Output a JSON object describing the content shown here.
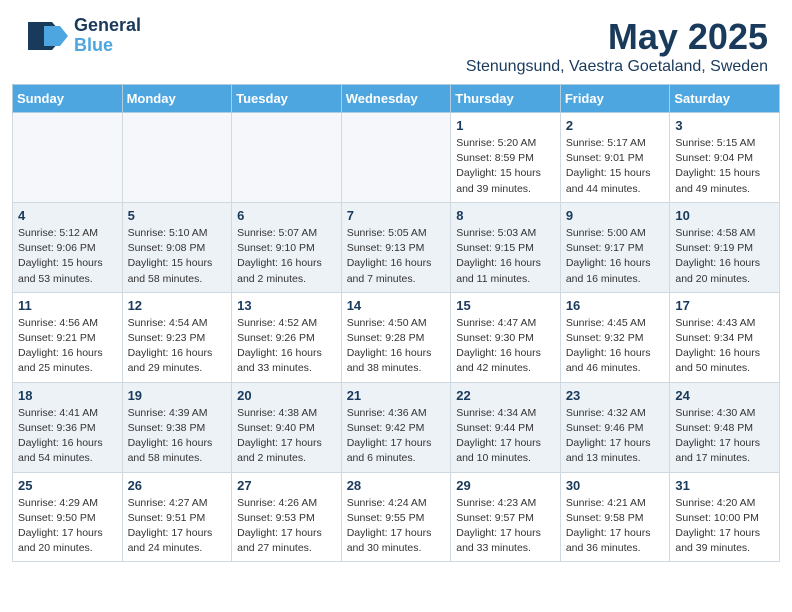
{
  "header": {
    "logo_general": "General",
    "logo_blue": "Blue",
    "month_year": "May 2025",
    "location": "Stenungsund, Vaestra Goetaland, Sweden"
  },
  "days_of_week": [
    "Sunday",
    "Monday",
    "Tuesday",
    "Wednesday",
    "Thursday",
    "Friday",
    "Saturday"
  ],
  "weeks": [
    [
      {
        "day": "",
        "info": ""
      },
      {
        "day": "",
        "info": ""
      },
      {
        "day": "",
        "info": ""
      },
      {
        "day": "",
        "info": ""
      },
      {
        "day": "1",
        "info": "Sunrise: 5:20 AM\nSunset: 8:59 PM\nDaylight: 15 hours\nand 39 minutes."
      },
      {
        "day": "2",
        "info": "Sunrise: 5:17 AM\nSunset: 9:01 PM\nDaylight: 15 hours\nand 44 minutes."
      },
      {
        "day": "3",
        "info": "Sunrise: 5:15 AM\nSunset: 9:04 PM\nDaylight: 15 hours\nand 49 minutes."
      }
    ],
    [
      {
        "day": "4",
        "info": "Sunrise: 5:12 AM\nSunset: 9:06 PM\nDaylight: 15 hours\nand 53 minutes."
      },
      {
        "day": "5",
        "info": "Sunrise: 5:10 AM\nSunset: 9:08 PM\nDaylight: 15 hours\nand 58 minutes."
      },
      {
        "day": "6",
        "info": "Sunrise: 5:07 AM\nSunset: 9:10 PM\nDaylight: 16 hours\nand 2 minutes."
      },
      {
        "day": "7",
        "info": "Sunrise: 5:05 AM\nSunset: 9:13 PM\nDaylight: 16 hours\nand 7 minutes."
      },
      {
        "day": "8",
        "info": "Sunrise: 5:03 AM\nSunset: 9:15 PM\nDaylight: 16 hours\nand 11 minutes."
      },
      {
        "day": "9",
        "info": "Sunrise: 5:00 AM\nSunset: 9:17 PM\nDaylight: 16 hours\nand 16 minutes."
      },
      {
        "day": "10",
        "info": "Sunrise: 4:58 AM\nSunset: 9:19 PM\nDaylight: 16 hours\nand 20 minutes."
      }
    ],
    [
      {
        "day": "11",
        "info": "Sunrise: 4:56 AM\nSunset: 9:21 PM\nDaylight: 16 hours\nand 25 minutes."
      },
      {
        "day": "12",
        "info": "Sunrise: 4:54 AM\nSunset: 9:23 PM\nDaylight: 16 hours\nand 29 minutes."
      },
      {
        "day": "13",
        "info": "Sunrise: 4:52 AM\nSunset: 9:26 PM\nDaylight: 16 hours\nand 33 minutes."
      },
      {
        "day": "14",
        "info": "Sunrise: 4:50 AM\nSunset: 9:28 PM\nDaylight: 16 hours\nand 38 minutes."
      },
      {
        "day": "15",
        "info": "Sunrise: 4:47 AM\nSunset: 9:30 PM\nDaylight: 16 hours\nand 42 minutes."
      },
      {
        "day": "16",
        "info": "Sunrise: 4:45 AM\nSunset: 9:32 PM\nDaylight: 16 hours\nand 46 minutes."
      },
      {
        "day": "17",
        "info": "Sunrise: 4:43 AM\nSunset: 9:34 PM\nDaylight: 16 hours\nand 50 minutes."
      }
    ],
    [
      {
        "day": "18",
        "info": "Sunrise: 4:41 AM\nSunset: 9:36 PM\nDaylight: 16 hours\nand 54 minutes."
      },
      {
        "day": "19",
        "info": "Sunrise: 4:39 AM\nSunset: 9:38 PM\nDaylight: 16 hours\nand 58 minutes."
      },
      {
        "day": "20",
        "info": "Sunrise: 4:38 AM\nSunset: 9:40 PM\nDaylight: 17 hours\nand 2 minutes."
      },
      {
        "day": "21",
        "info": "Sunrise: 4:36 AM\nSunset: 9:42 PM\nDaylight: 17 hours\nand 6 minutes."
      },
      {
        "day": "22",
        "info": "Sunrise: 4:34 AM\nSunset: 9:44 PM\nDaylight: 17 hours\nand 10 minutes."
      },
      {
        "day": "23",
        "info": "Sunrise: 4:32 AM\nSunset: 9:46 PM\nDaylight: 17 hours\nand 13 minutes."
      },
      {
        "day": "24",
        "info": "Sunrise: 4:30 AM\nSunset: 9:48 PM\nDaylight: 17 hours\nand 17 minutes."
      }
    ],
    [
      {
        "day": "25",
        "info": "Sunrise: 4:29 AM\nSunset: 9:50 PM\nDaylight: 17 hours\nand 20 minutes."
      },
      {
        "day": "26",
        "info": "Sunrise: 4:27 AM\nSunset: 9:51 PM\nDaylight: 17 hours\nand 24 minutes."
      },
      {
        "day": "27",
        "info": "Sunrise: 4:26 AM\nSunset: 9:53 PM\nDaylight: 17 hours\nand 27 minutes."
      },
      {
        "day": "28",
        "info": "Sunrise: 4:24 AM\nSunset: 9:55 PM\nDaylight: 17 hours\nand 30 minutes."
      },
      {
        "day": "29",
        "info": "Sunrise: 4:23 AM\nSunset: 9:57 PM\nDaylight: 17 hours\nand 33 minutes."
      },
      {
        "day": "30",
        "info": "Sunrise: 4:21 AM\nSunset: 9:58 PM\nDaylight: 17 hours\nand 36 minutes."
      },
      {
        "day": "31",
        "info": "Sunrise: 4:20 AM\nSunset: 10:00 PM\nDaylight: 17 hours\nand 39 minutes."
      }
    ]
  ]
}
